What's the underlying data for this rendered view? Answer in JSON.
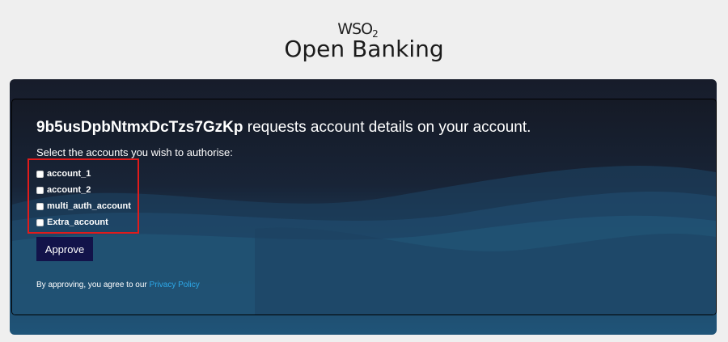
{
  "logo": {
    "mark": "WSO",
    "mark_sub": "2",
    "brand": "Open Banking"
  },
  "consent": {
    "client_id": "9b5usDpbNtmxDcTzs7GzKp",
    "request_text": " requests account details on your account.",
    "select_prompt": "Select the accounts you wish to authorise:",
    "accounts": [
      {
        "label": "account_1",
        "checked": false
      },
      {
        "label": "account_2",
        "checked": false
      },
      {
        "label": "multi_auth_account",
        "checked": false
      },
      {
        "label": "Extra_account",
        "checked": false
      }
    ],
    "approve_label": "Approve",
    "agree_text": "By approving, you agree to our ",
    "privacy_link": "Privacy Policy"
  },
  "colors": {
    "page_bg": "#efefef",
    "approve_bg": "#12134a",
    "link": "#2da8e8",
    "highlight": "#e11b1b"
  }
}
